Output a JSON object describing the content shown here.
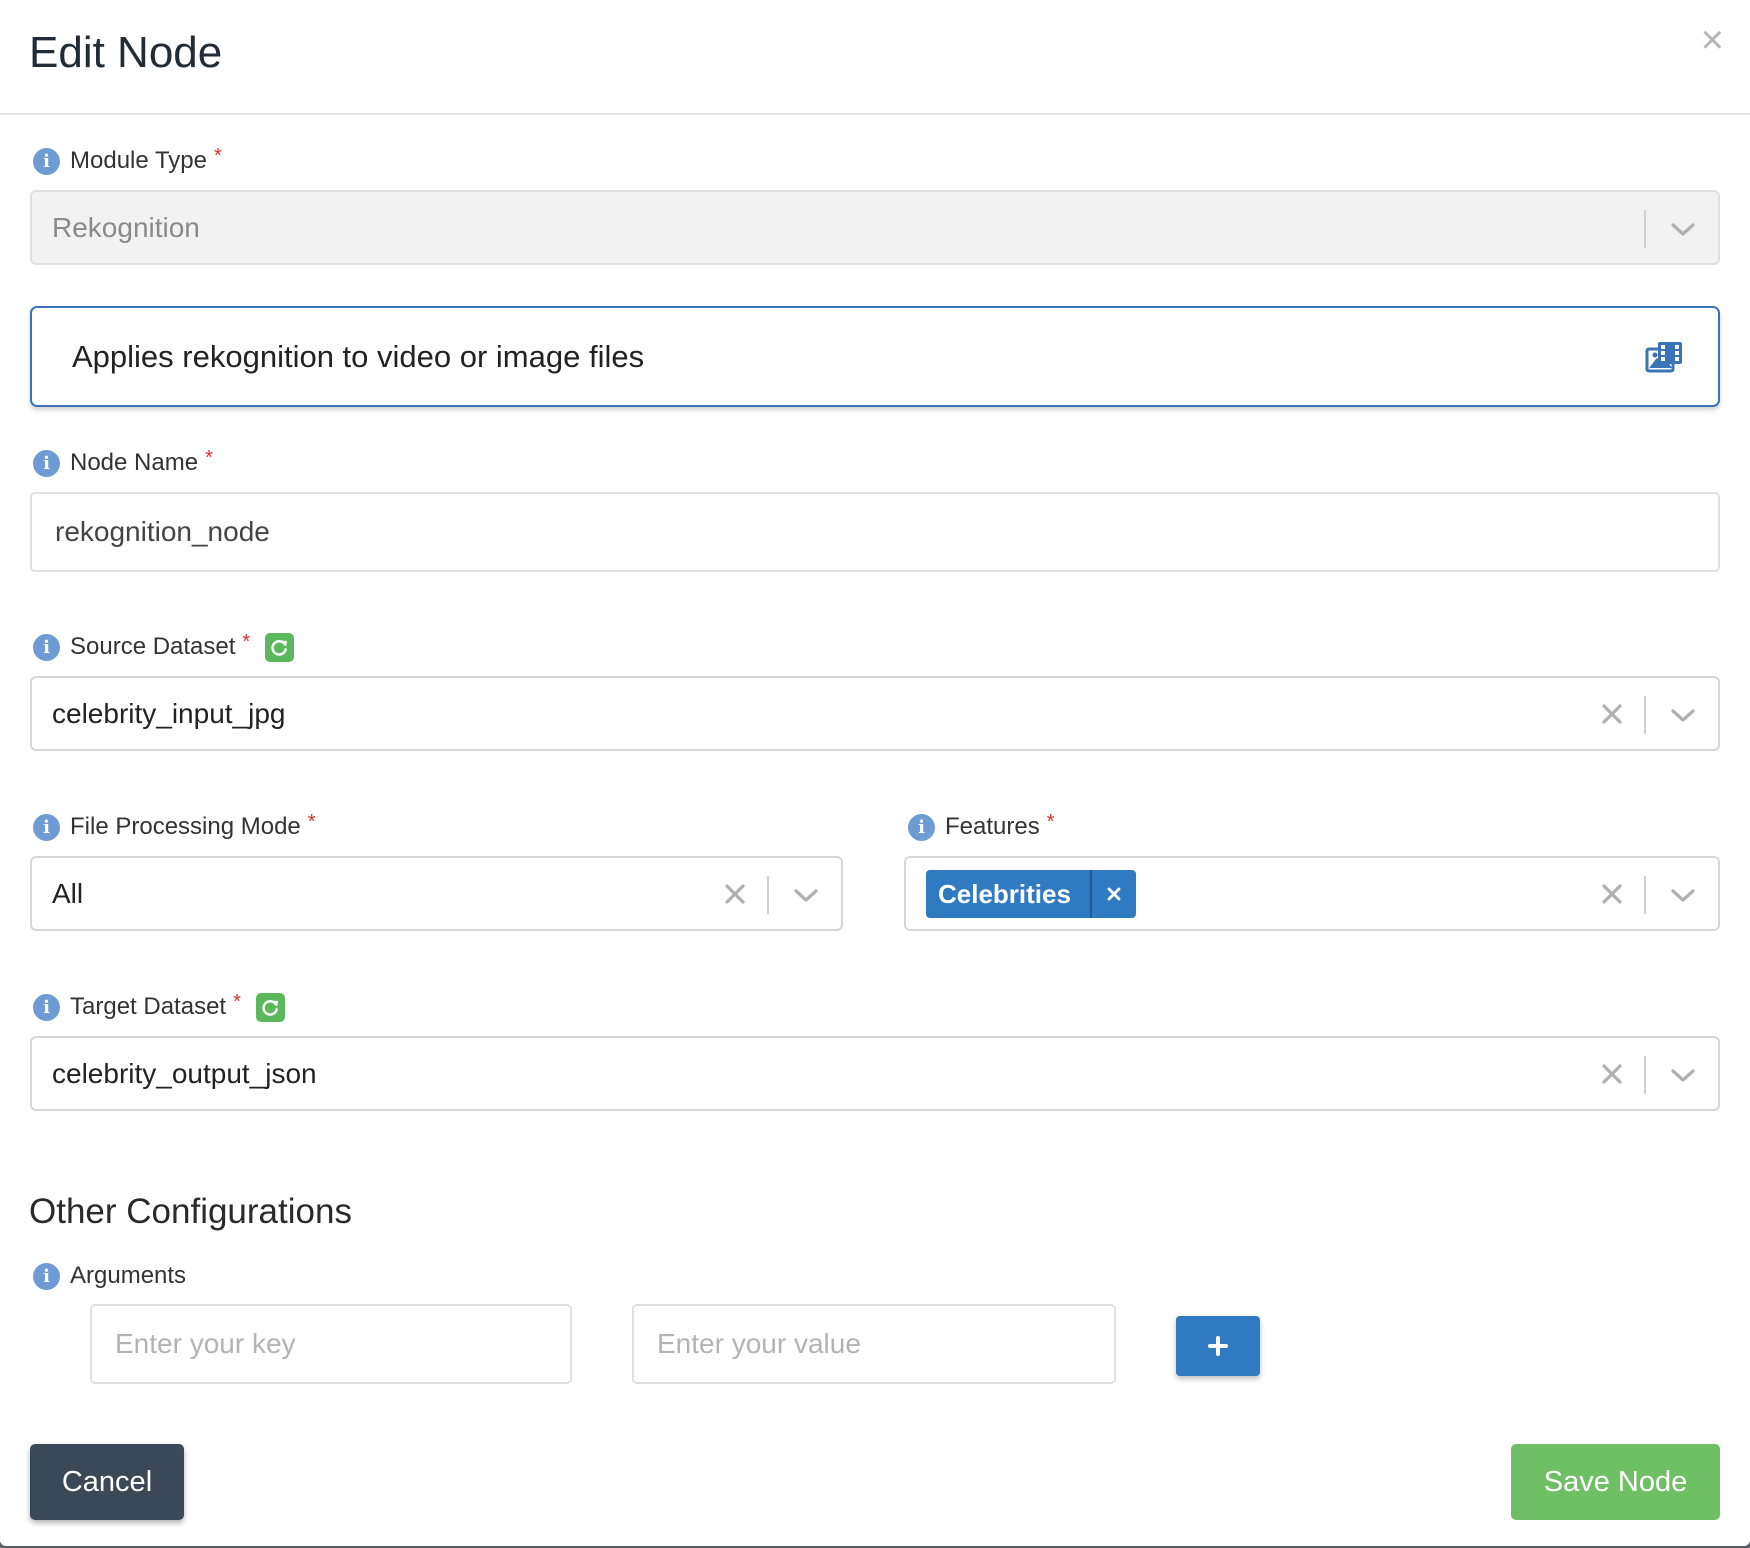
{
  "dialog": {
    "title": "Edit Node",
    "close_label": "×"
  },
  "module_type": {
    "label": "Module Type",
    "required_mark": "*",
    "value": "Rekognition",
    "disabled": true
  },
  "description": {
    "text": "Applies rekognition to video or image files",
    "icon": "photo-film-icon"
  },
  "node_name": {
    "label": "Node Name",
    "required_mark": "*",
    "value": "rekognition_node"
  },
  "source_dataset": {
    "label": "Source Dataset",
    "required_mark": "*",
    "value": "celebrity_input_jpg"
  },
  "file_processing_mode": {
    "label": "File Processing Mode",
    "required_mark": "*",
    "value": "All"
  },
  "features": {
    "label": "Features",
    "required_mark": "*",
    "tags": [
      "Celebrities"
    ]
  },
  "target_dataset": {
    "label": "Target Dataset",
    "required_mark": "*",
    "value": "celebrity_output_json"
  },
  "other_configurations": {
    "title": "Other Configurations",
    "arguments_label": "Arguments",
    "key_placeholder": "Enter your key",
    "value_placeholder": "Enter your value",
    "add_label": "+"
  },
  "footer": {
    "cancel_label": "Cancel",
    "save_label": "Save Node"
  },
  "colors": {
    "primary": "#2f7ac0",
    "success": "#6fbf65",
    "dark": "#3b4858",
    "required": "#e03030",
    "info": "#6e9bd4"
  }
}
